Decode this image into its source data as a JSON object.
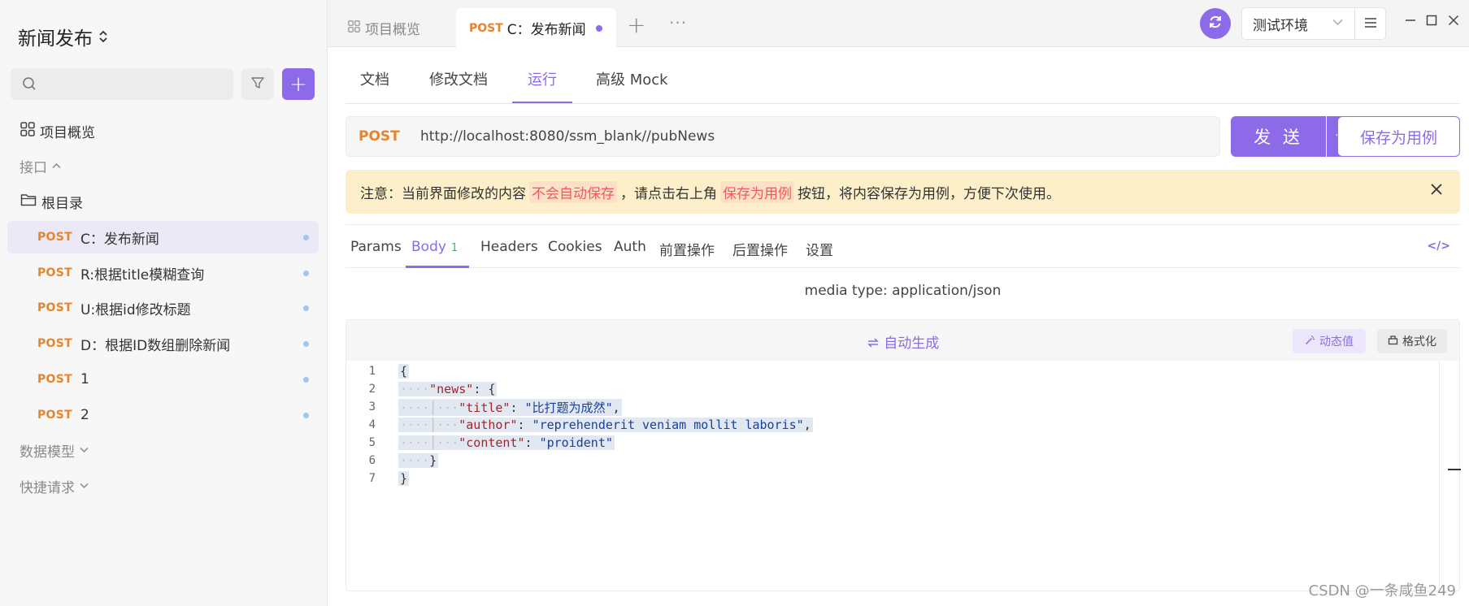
{
  "sidebar": {
    "project_title": "新闻发布",
    "project_switch_icon": "updown-chevron-icon",
    "search": {
      "placeholder": "",
      "icon": "search-icon"
    },
    "filter_icon": "filter-icon",
    "add_label": "+",
    "overview_label": "项目概览",
    "interfaces_label": "接口",
    "root_folder_label": "根目录",
    "api_items": [
      {
        "method": "POST",
        "name": "C：发布新闻"
      },
      {
        "method": "POST",
        "name": "R:根据title模糊查询"
      },
      {
        "method": "POST",
        "name": "U:根据id修改标题"
      },
      {
        "method": "POST",
        "name": "D：根据ID数组删除新闻"
      },
      {
        "method": "POST",
        "name": "1"
      },
      {
        "method": "POST",
        "name": "2"
      }
    ],
    "data_model_label": "数据模型",
    "quick_request_label": "快捷请求"
  },
  "tabbar": {
    "overview_tab": "项目概览",
    "active_tab": {
      "method": "POST",
      "name": "C：发布新闻"
    },
    "plus": "+",
    "more": "···",
    "environment": "测试环境",
    "accent": "#8d6be8"
  },
  "subtabs": [
    "文档",
    "修改文档",
    "运行",
    "高级 Mock"
  ],
  "request": {
    "method": "POST",
    "url": "http://localhost:8080/ssm_blank//pubNews",
    "send_label": "发 送",
    "save_case_label": "保存为用例"
  },
  "notice": {
    "prefix": "注意：当前界面修改的内容",
    "hl1": "不会自动保存",
    "middle": "，请点击右上角",
    "hl2": "保存为用例",
    "suffix": "按钮，将内容保存为用例，方便下次使用。"
  },
  "param_tabs": [
    {
      "label": "Params"
    },
    {
      "label": "Body",
      "badge": "1"
    },
    {
      "label": "Headers"
    },
    {
      "label": "Cookies"
    },
    {
      "label": "Auth"
    },
    {
      "label": "前置操作"
    },
    {
      "label": "后置操作"
    },
    {
      "label": "设置"
    }
  ],
  "code_icon_label": "</>",
  "media_type": "media type: application/json",
  "editor": {
    "autogen_label": "自动生成",
    "dynamic_label": "动态值",
    "format_label": "格式化",
    "line_numbers": [
      "1",
      "2",
      "3",
      "4",
      "5",
      "6",
      "7"
    ]
  },
  "watermark": "CSDN @一条咸鱼249"
}
